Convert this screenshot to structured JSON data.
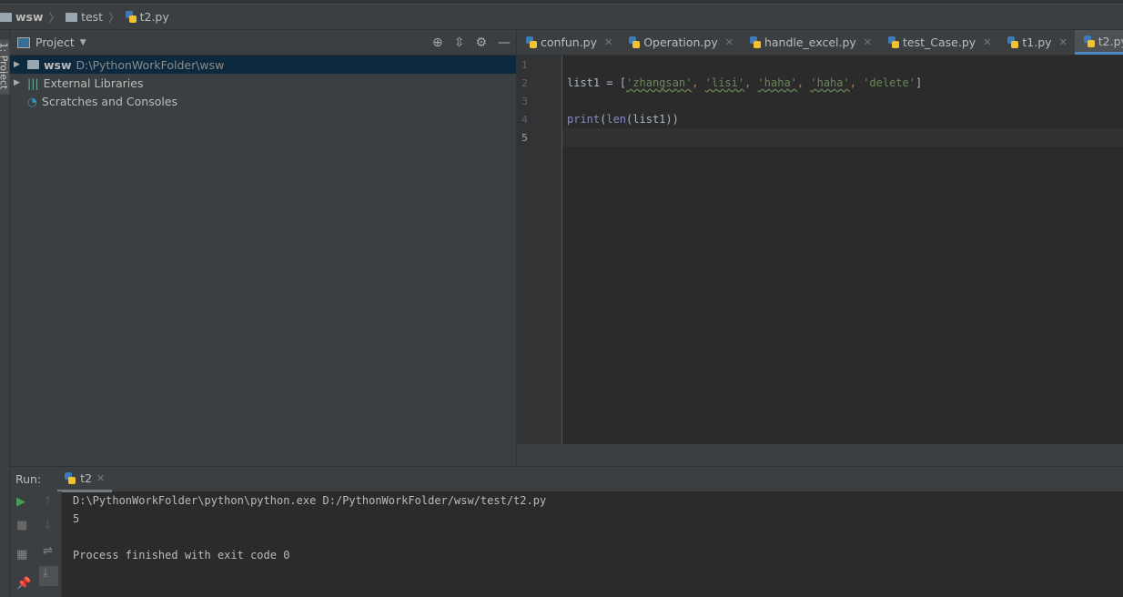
{
  "breadcrumb": [
    "wsw",
    "test",
    "t2.py"
  ],
  "sidebar_strip_label": "1: Project",
  "project": {
    "title": "Project",
    "tree": [
      {
        "name": "wsw",
        "path": "D:\\PythonWorkFolder\\wsw",
        "selected": true
      },
      {
        "name": "External Libraries"
      },
      {
        "name": "Scratches and Consoles"
      }
    ]
  },
  "tabs": [
    {
      "label": "confun.py"
    },
    {
      "label": "Operation.py"
    },
    {
      "label": "handle_excel.py"
    },
    {
      "label": "test_Case.py"
    },
    {
      "label": "t1.py"
    },
    {
      "label": "t2.py",
      "active": true
    }
  ],
  "editor": {
    "line_numbers": [
      "1",
      "2",
      "3",
      "4",
      "5"
    ],
    "current_line": 5,
    "code": {
      "l2": {
        "var": "list1",
        "eq": " = ",
        "open": "[",
        "s1": "'zhangsan'",
        "s2": "'lisi'",
        "s3": "'haha'",
        "s4": "'haha'",
        "s5": "'delete'",
        "close": "]",
        "comma": ", "
      },
      "l4": {
        "fn": "print",
        "rest1": "(",
        "len": "len",
        "rest2": "(list1))"
      }
    }
  },
  "run": {
    "label": "Run:",
    "tab": "t2",
    "output": [
      "D:\\PythonWorkFolder\\python\\python.exe D:/PythonWorkFolder/wsw/test/t2.py",
      "5",
      "",
      "Process finished with exit code 0"
    ]
  },
  "colors": {
    "accent": "#4a88c7",
    "selection": "#0d293e",
    "string": "#6a8759",
    "keyword": "#cc7832",
    "builtin": "#8888c6",
    "run_green": "#499c54"
  }
}
